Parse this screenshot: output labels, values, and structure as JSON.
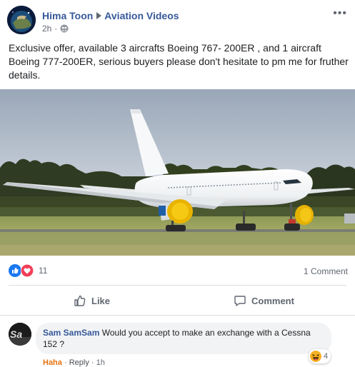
{
  "post": {
    "author": "Hima Toon",
    "group": "Aviation Videos",
    "time": "2h",
    "text": "Exclusive offer, available 3 aircrafts Boeing 767- 200ER , and 1 aircraft Boeing 777-200ER, serious buyers please don't hesitate to pm me for fruther details."
  },
  "stats": {
    "reaction_count": "11",
    "comment_count": "1 Comment"
  },
  "actions": {
    "like": "Like",
    "comment": "Comment"
  },
  "comment": {
    "author": "Sam SamSam",
    "text": "Would you accept to make an exchange with a Cessna 152 ?",
    "haha": "Haha",
    "sep1": "·",
    "reply": "Reply",
    "sep2": "·",
    "time": "1h",
    "reaction_count": "4"
  },
  "colors": {
    "link": "#365899",
    "secondary_text": "#606770",
    "like_blue": "#1877f2",
    "love_red": "#f33e58",
    "haha_yellow": "#f7b125"
  }
}
